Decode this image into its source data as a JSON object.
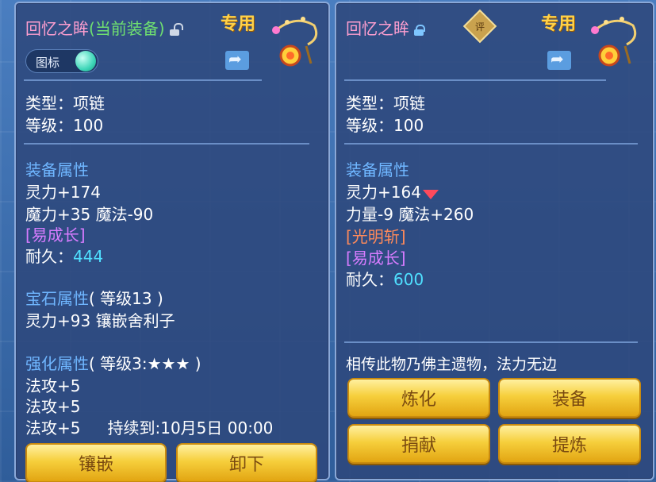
{
  "left": {
    "title": "回忆之眸",
    "title_equipped": "(当前装备)",
    "exclusive": "专用",
    "icon_toggle_label": "图标",
    "type_line": "类型：项链",
    "level_line": "等级：100",
    "attr_header": "装备属性",
    "attrs": [
      "灵力+174",
      "魔力+35 魔法-90"
    ],
    "trait": "[易成长]",
    "durability_label": "耐久：",
    "durability_value": "444",
    "gem_header": "宝石属性",
    "gem_level": "( 等级13 )",
    "gem_effect": "灵力+93 镶嵌舍利子",
    "enhance_header": "强化属性",
    "enhance_level": "( 等级3:★★★ )",
    "enhance_lines": [
      "法攻+5",
      "法攻+5"
    ],
    "enhance_last": "法攻+5",
    "enhance_duration": "持续到:10月5日 00:00",
    "buttons": [
      "镶嵌",
      "卸下"
    ]
  },
  "right": {
    "title": "回忆之眸",
    "rate_badge": "评",
    "exclusive": "专用",
    "type_line": "类型：项链",
    "level_line": "等级：100",
    "attr_header": "装备属性",
    "attr1": "灵力+164",
    "attr2": "力量-9 魔法+260",
    "trait1": "[光明斩]",
    "trait2": "[易成长]",
    "durability_label": "耐久：",
    "durability_value": "600",
    "lore": "相传此物乃佛主遗物，法力无边",
    "buttons": [
      "炼化",
      "装备",
      "捐献",
      "提炼"
    ]
  },
  "colors": {
    "title_pink": "#ff9fd0",
    "equipped_green": "#6fe070",
    "header_blue": "#6fb6ff",
    "trait_purple": "#d77cff",
    "durability_cyan": "#4fe0ff",
    "trait_orange": "#ff8a5a",
    "button_gold": "#f6cf3c"
  }
}
